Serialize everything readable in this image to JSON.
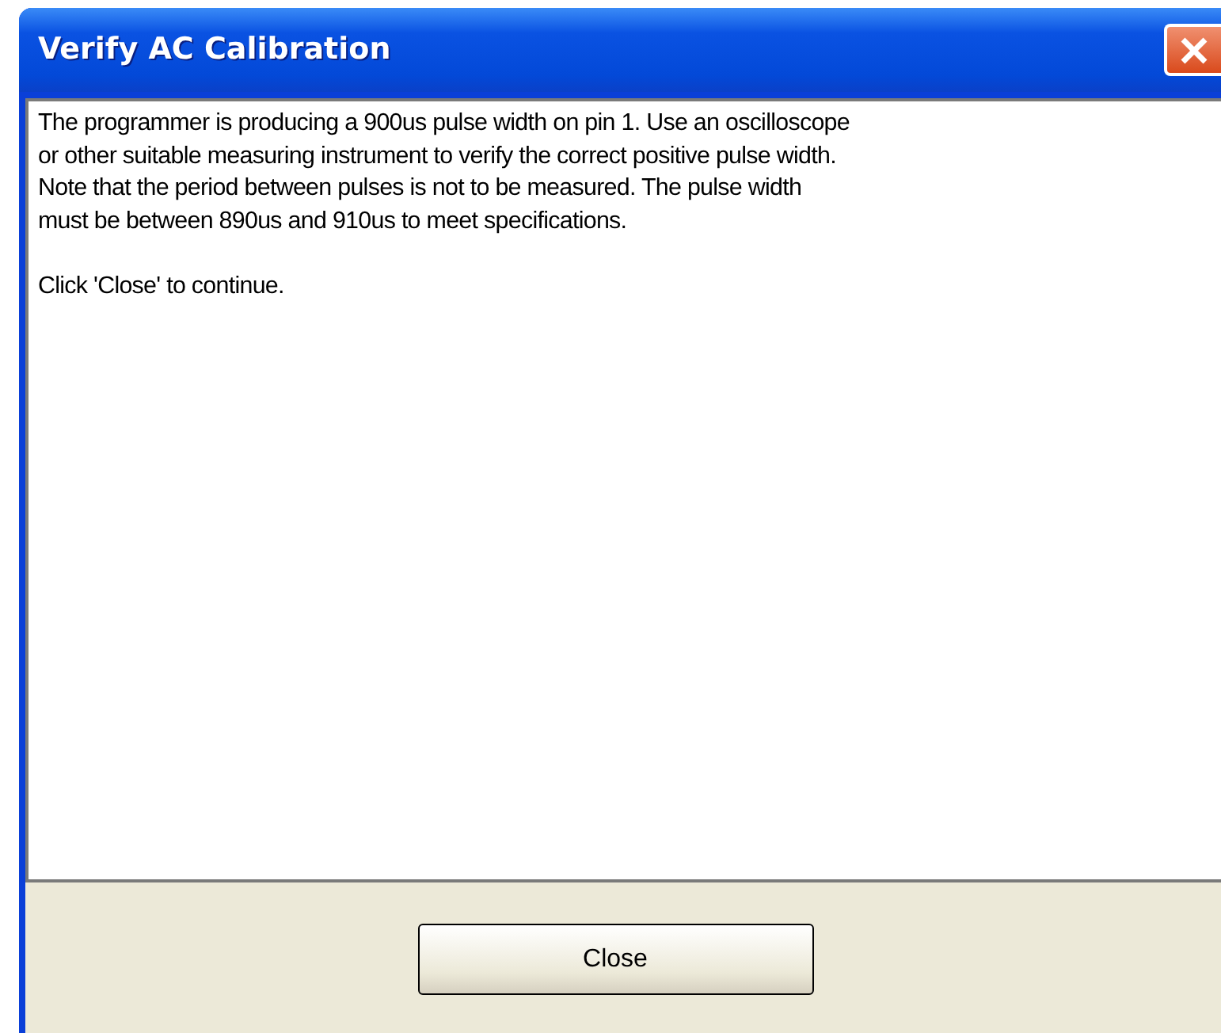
{
  "window": {
    "title": "Verify AC Calibration"
  },
  "message": {
    "paragraphs": [
      [
        "The programmer is producing a 900us pulse width on pin 1. Use an oscilloscope",
        "or other suitable measuring instrument to verify the correct positive pulse width.",
        "Note that the period between pulses is not to be measured. The pulse width",
        "must be between 890us and 910us to meet specifications."
      ],
      [
        "Click 'Close' to continue."
      ]
    ]
  },
  "buttons": [
    {
      "label": "Close"
    }
  ]
}
